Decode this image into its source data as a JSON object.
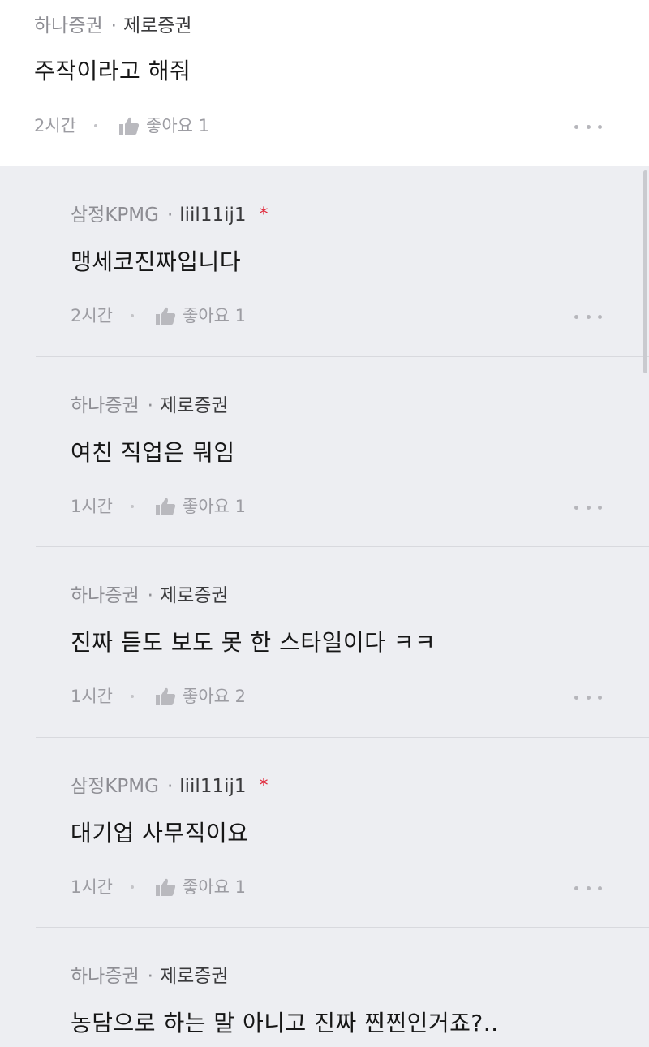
{
  "top_comment": {
    "company": "하나증권",
    "separator": "·",
    "nickname": "제로증권",
    "text": "주작이라고 해줘",
    "time": "2시간",
    "like_label": "좋아요 1"
  },
  "replies": [
    {
      "company": "삼정KPMG",
      "separator": "·",
      "nickname": "liil11ij1",
      "author_mark": "*",
      "text": "맹세코진짜입니다",
      "time": "2시간",
      "like_label": "좋아요 1"
    },
    {
      "company": "하나증권",
      "separator": "·",
      "nickname": "제로증권",
      "text": "여친 직업은 뭐임",
      "time": "1시간",
      "like_label": "좋아요 1"
    },
    {
      "company": "하나증권",
      "separator": "·",
      "nickname": "제로증권",
      "text": "진짜 듣도 보도 못 한 스타일이다 ㅋㅋ",
      "time": "1시간",
      "like_label": "좋아요 2"
    },
    {
      "company": "삼정KPMG",
      "separator": "·",
      "nickname": "liil11ij1",
      "author_mark": "*",
      "text": "대기업 사무직이요",
      "time": "1시간",
      "like_label": "좋아요 1"
    },
    {
      "company": "하나증권",
      "separator": "·",
      "nickname": "제로증권",
      "text": "농담으로 하는 말 아니고 진짜 찐찐인거죠?.."
    }
  ],
  "icons": {
    "like": "thumbs-up-icon",
    "more": "more-dots-icon"
  },
  "colors": {
    "top_background": "#ffffff",
    "reply_background": "#edeef2",
    "author_mark": "#e0283a",
    "meta_gray": "#8d8d93"
  }
}
